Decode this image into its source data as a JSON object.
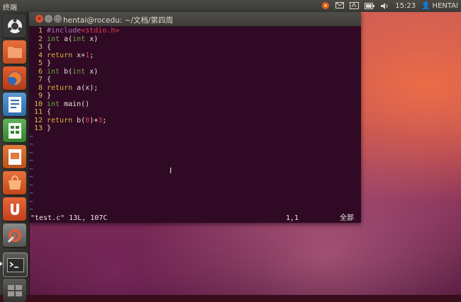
{
  "top_panel": {
    "app_title": "终端",
    "clock": "15:23",
    "user_name": "HENTAI",
    "indicator_icons": [
      "update-icon",
      "mail-icon",
      "keyboard-icon",
      "battery-icon",
      "volume-icon",
      "user-icon"
    ]
  },
  "launcher": {
    "items": [
      {
        "name": "dash-home-icon"
      },
      {
        "name": "files-folder-icon"
      },
      {
        "name": "firefox-icon"
      },
      {
        "name": "writer-icon"
      },
      {
        "name": "calc-icon"
      },
      {
        "name": "impress-icon"
      },
      {
        "name": "software-center-icon"
      },
      {
        "name": "ubuntu-one-icon"
      },
      {
        "name": "system-settings-icon"
      },
      {
        "name": "terminal-icon"
      },
      {
        "name": "workspace-switcher-icon"
      }
    ]
  },
  "window": {
    "title": "hentai@rocedu: ~/文档/第四周"
  },
  "editor": {
    "lines": [
      {
        "num": "1",
        "tokens": [
          {
            "t": "#include",
            "c": "tok-pre"
          },
          {
            "t": "<stdio.h>",
            "c": "tok-inc"
          }
        ]
      },
      {
        "num": "2",
        "tokens": [
          {
            "t": "int",
            "c": "tok-type"
          },
          {
            "t": " a(",
            "c": "tok-txt"
          },
          {
            "t": "int",
            "c": "tok-type"
          },
          {
            "t": " x)",
            "c": "tok-txt"
          }
        ]
      },
      {
        "num": "3",
        "tokens": [
          {
            "t": "{",
            "c": "tok-txt"
          }
        ]
      },
      {
        "num": "4",
        "tokens": [
          {
            "t": "return",
            "c": "tok-kw"
          },
          {
            "t": " x+",
            "c": "tok-txt"
          },
          {
            "t": "1",
            "c": "tok-num"
          },
          {
            "t": ";",
            "c": "tok-txt"
          }
        ]
      },
      {
        "num": "5",
        "tokens": [
          {
            "t": "}",
            "c": "tok-txt"
          }
        ]
      },
      {
        "num": "6",
        "tokens": [
          {
            "t": "int",
            "c": "tok-type"
          },
          {
            "t": " b(",
            "c": "tok-txt"
          },
          {
            "t": "int",
            "c": "tok-type"
          },
          {
            "t": " x)",
            "c": "tok-txt"
          }
        ]
      },
      {
        "num": "7",
        "tokens": [
          {
            "t": "{",
            "c": "tok-txt"
          }
        ]
      },
      {
        "num": "8",
        "tokens": [
          {
            "t": "return",
            "c": "tok-kw"
          },
          {
            "t": " a(x);",
            "c": "tok-txt"
          }
        ]
      },
      {
        "num": "9",
        "tokens": [
          {
            "t": "}",
            "c": "tok-txt"
          }
        ]
      },
      {
        "num": "10",
        "tokens": [
          {
            "t": "int",
            "c": "tok-type"
          },
          {
            "t": " main()",
            "c": "tok-txt"
          }
        ]
      },
      {
        "num": "11",
        "tokens": [
          {
            "t": "{",
            "c": "tok-txt"
          }
        ]
      },
      {
        "num": "12",
        "tokens": [
          {
            "t": "return",
            "c": "tok-kw"
          },
          {
            "t": " b(",
            "c": "tok-txt"
          },
          {
            "t": "0",
            "c": "tok-num"
          },
          {
            "t": ")+",
            "c": "tok-txt"
          },
          {
            "t": "3",
            "c": "tok-num"
          },
          {
            "t": ";",
            "c": "tok-txt"
          }
        ]
      },
      {
        "num": "13",
        "tokens": [
          {
            "t": "}",
            "c": "tok-txt"
          }
        ]
      }
    ],
    "tilde": "~",
    "tilde_count": 10,
    "status_file": "\"test.c\" 13L, 107C",
    "status_pos": "1,1",
    "status_scroll": "全部"
  },
  "colors": {
    "terminal_bg": "#300a24",
    "line_number": "#d3c14c",
    "type_green": "#6aaa44",
    "keyword_yellow": "#d7b339",
    "number_red": "#e0414f",
    "tilde_blue": "#5c84c8"
  }
}
